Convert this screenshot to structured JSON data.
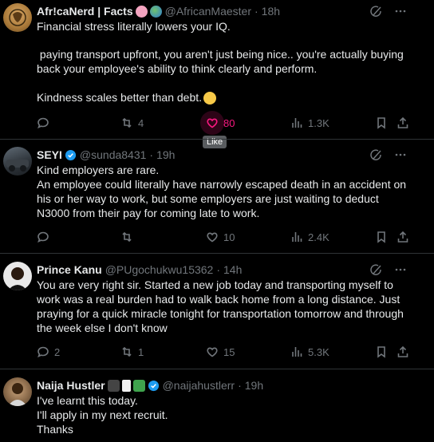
{
  "posts": [
    {
      "name": "Afr!caNerd | Facts",
      "handle": "@AfricanMaester",
      "time": "18h",
      "lines": [
        "Financial stress literally lowers your IQ.",
        "",
        " paying transport upfront, you aren't just being nice.. you're actually buying",
        "back your employee's ability to think clearly and perform.",
        "",
        "Kindness scales better than debt."
      ],
      "replies": "",
      "reposts": "4",
      "likes": "80",
      "views": "1.3K",
      "tooltip": "Like"
    },
    {
      "name": "SEYI",
      "handle": "@sunda8431",
      "time": "19h",
      "lines": [
        "Kind employers are rare.",
        "An employee could literally have narrowly escaped death in an accident on",
        "his or her way to work, but some employers are just waiting to deduct",
        "N3000 from their pay for coming late to work."
      ],
      "replies": "",
      "reposts": "",
      "likes": "10",
      "views": "2.4K"
    },
    {
      "name": "Prince Kanu",
      "handle": "@PUgochukwu15362",
      "time": "14h",
      "lines": [
        "You are very right sir. Started a new job today and transporting myself to",
        "work was a real burden had to walk back home from a long distance. Just",
        "praying for a quick miracle tonight for transportation tomorrow and through",
        "the week else I don't know"
      ],
      "replies": "2",
      "reposts": "1",
      "likes": "15",
      "views": "5.3K"
    },
    {
      "name": "Naija Hustler",
      "handle": "@naijahustlerr",
      "time": "19h",
      "lines": [
        "I've learnt this today.",
        "I'll apply in my next recruit.",
        "Thanks"
      ]
    }
  ],
  "separator": "·",
  "colors": {
    "accent_like": "#f91880",
    "muted": "#71767b",
    "verified": "#1d9bf0"
  }
}
